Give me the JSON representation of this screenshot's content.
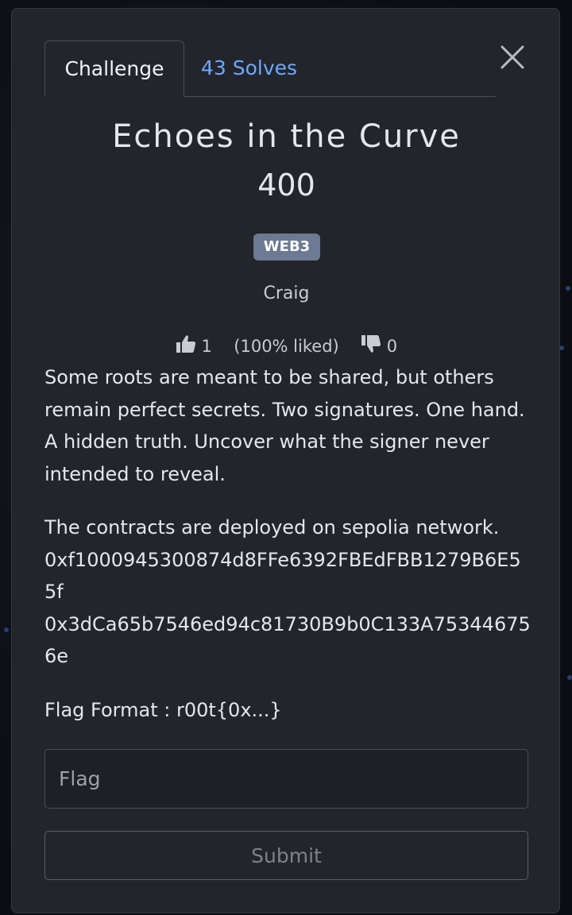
{
  "tabs": {
    "challenge_label": "Challenge",
    "solves_label": "43 Solves"
  },
  "challenge": {
    "title": "Echoes in the Curve",
    "points": "400",
    "category": "WEB3",
    "author": "Craig"
  },
  "ratings": {
    "likes": "1",
    "liked_pct": "(100% liked)",
    "dislikes": "0"
  },
  "description": {
    "paragraph1": "Some roots are meant to be shared, but others remain perfect secrets. Two signatures. One hand. A hidden truth. Uncover what the signer never intended to reveal.",
    "network_line": "The contracts are deployed on sepolia network.",
    "address1": "0xf1000945300874d8FFe6392FBEdFBB1279B6E55f",
    "address2": "0x3dCa65b7546ed94c81730B9b0C133A753446756e",
    "flag_format": "Flag Format : r00t{0x...}"
  },
  "form": {
    "flag_placeholder": "Flag",
    "submit_label": "Submit"
  },
  "colors": {
    "accent": "#6ea8ff",
    "badge": "#6c7a93",
    "modal_bg": "#22252b"
  }
}
